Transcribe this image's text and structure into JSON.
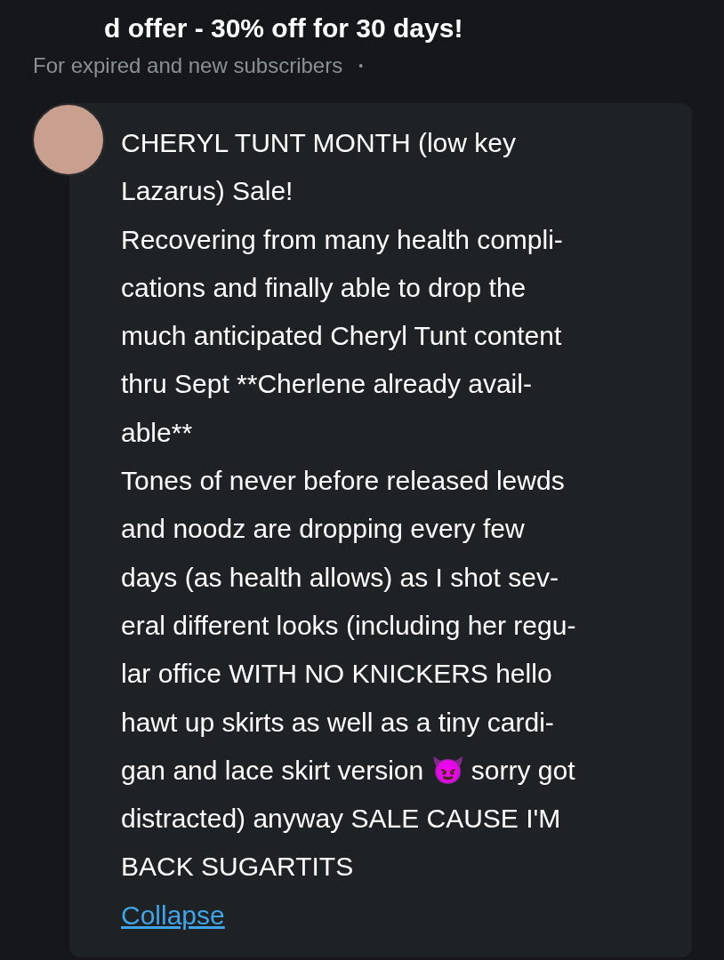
{
  "offer": {
    "title": "d offer - 30% off for 30 days!",
    "subtitle": "For expired and new subscribers",
    "separator": "•"
  },
  "post": {
    "paragraphs": [
      {
        "lines": [
          "CHERYL TUNT MONTH (low key",
          "Lazarus) Sale!"
        ]
      },
      {
        "lines": [
          "Recovering from many health compli-",
          "cations and finally able to drop the",
          "much anticipated Cheryl Tunt content",
          "thru Sept **Cherlene already avail-",
          "able**"
        ]
      },
      {
        "lines": [
          "Tones of never before released lewds",
          "and noodz are dropping every few",
          "days (as health allows) as I shot sev-",
          "eral different looks (including her regu-",
          "lar office WITH NO KNICKERS hello",
          "hawt up skirts as well as a tiny cardi-",
          "gan and lace skirt version 😈 sorry got",
          "distracted) anyway SALE CAUSE I'M",
          "BACK SUGARTITS"
        ]
      }
    ],
    "collapse_link": "Collapse"
  }
}
